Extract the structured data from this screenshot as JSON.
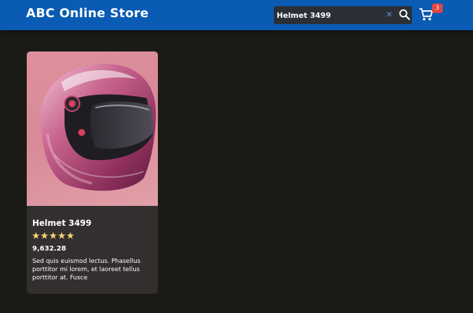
{
  "header": {
    "title": "ABC Online Store",
    "search": {
      "value": "Helmet 3499",
      "placeholder": ""
    },
    "clear_icon": "close-icon",
    "search_icon": "search-icon",
    "cart": {
      "icon": "cart-icon",
      "count": "3"
    },
    "colors": {
      "bar": "#0a5bb3",
      "badge": "#e4453e"
    }
  },
  "products": [
    {
      "name": "Helmet 3499",
      "rating": 5,
      "stars": "★★★★★",
      "price": "9,632.28",
      "description": "Sed quis euismod lectus. Phasellus porttitor mi lorem, et laoreet tellus porttitor at. Fusce"
    }
  ]
}
